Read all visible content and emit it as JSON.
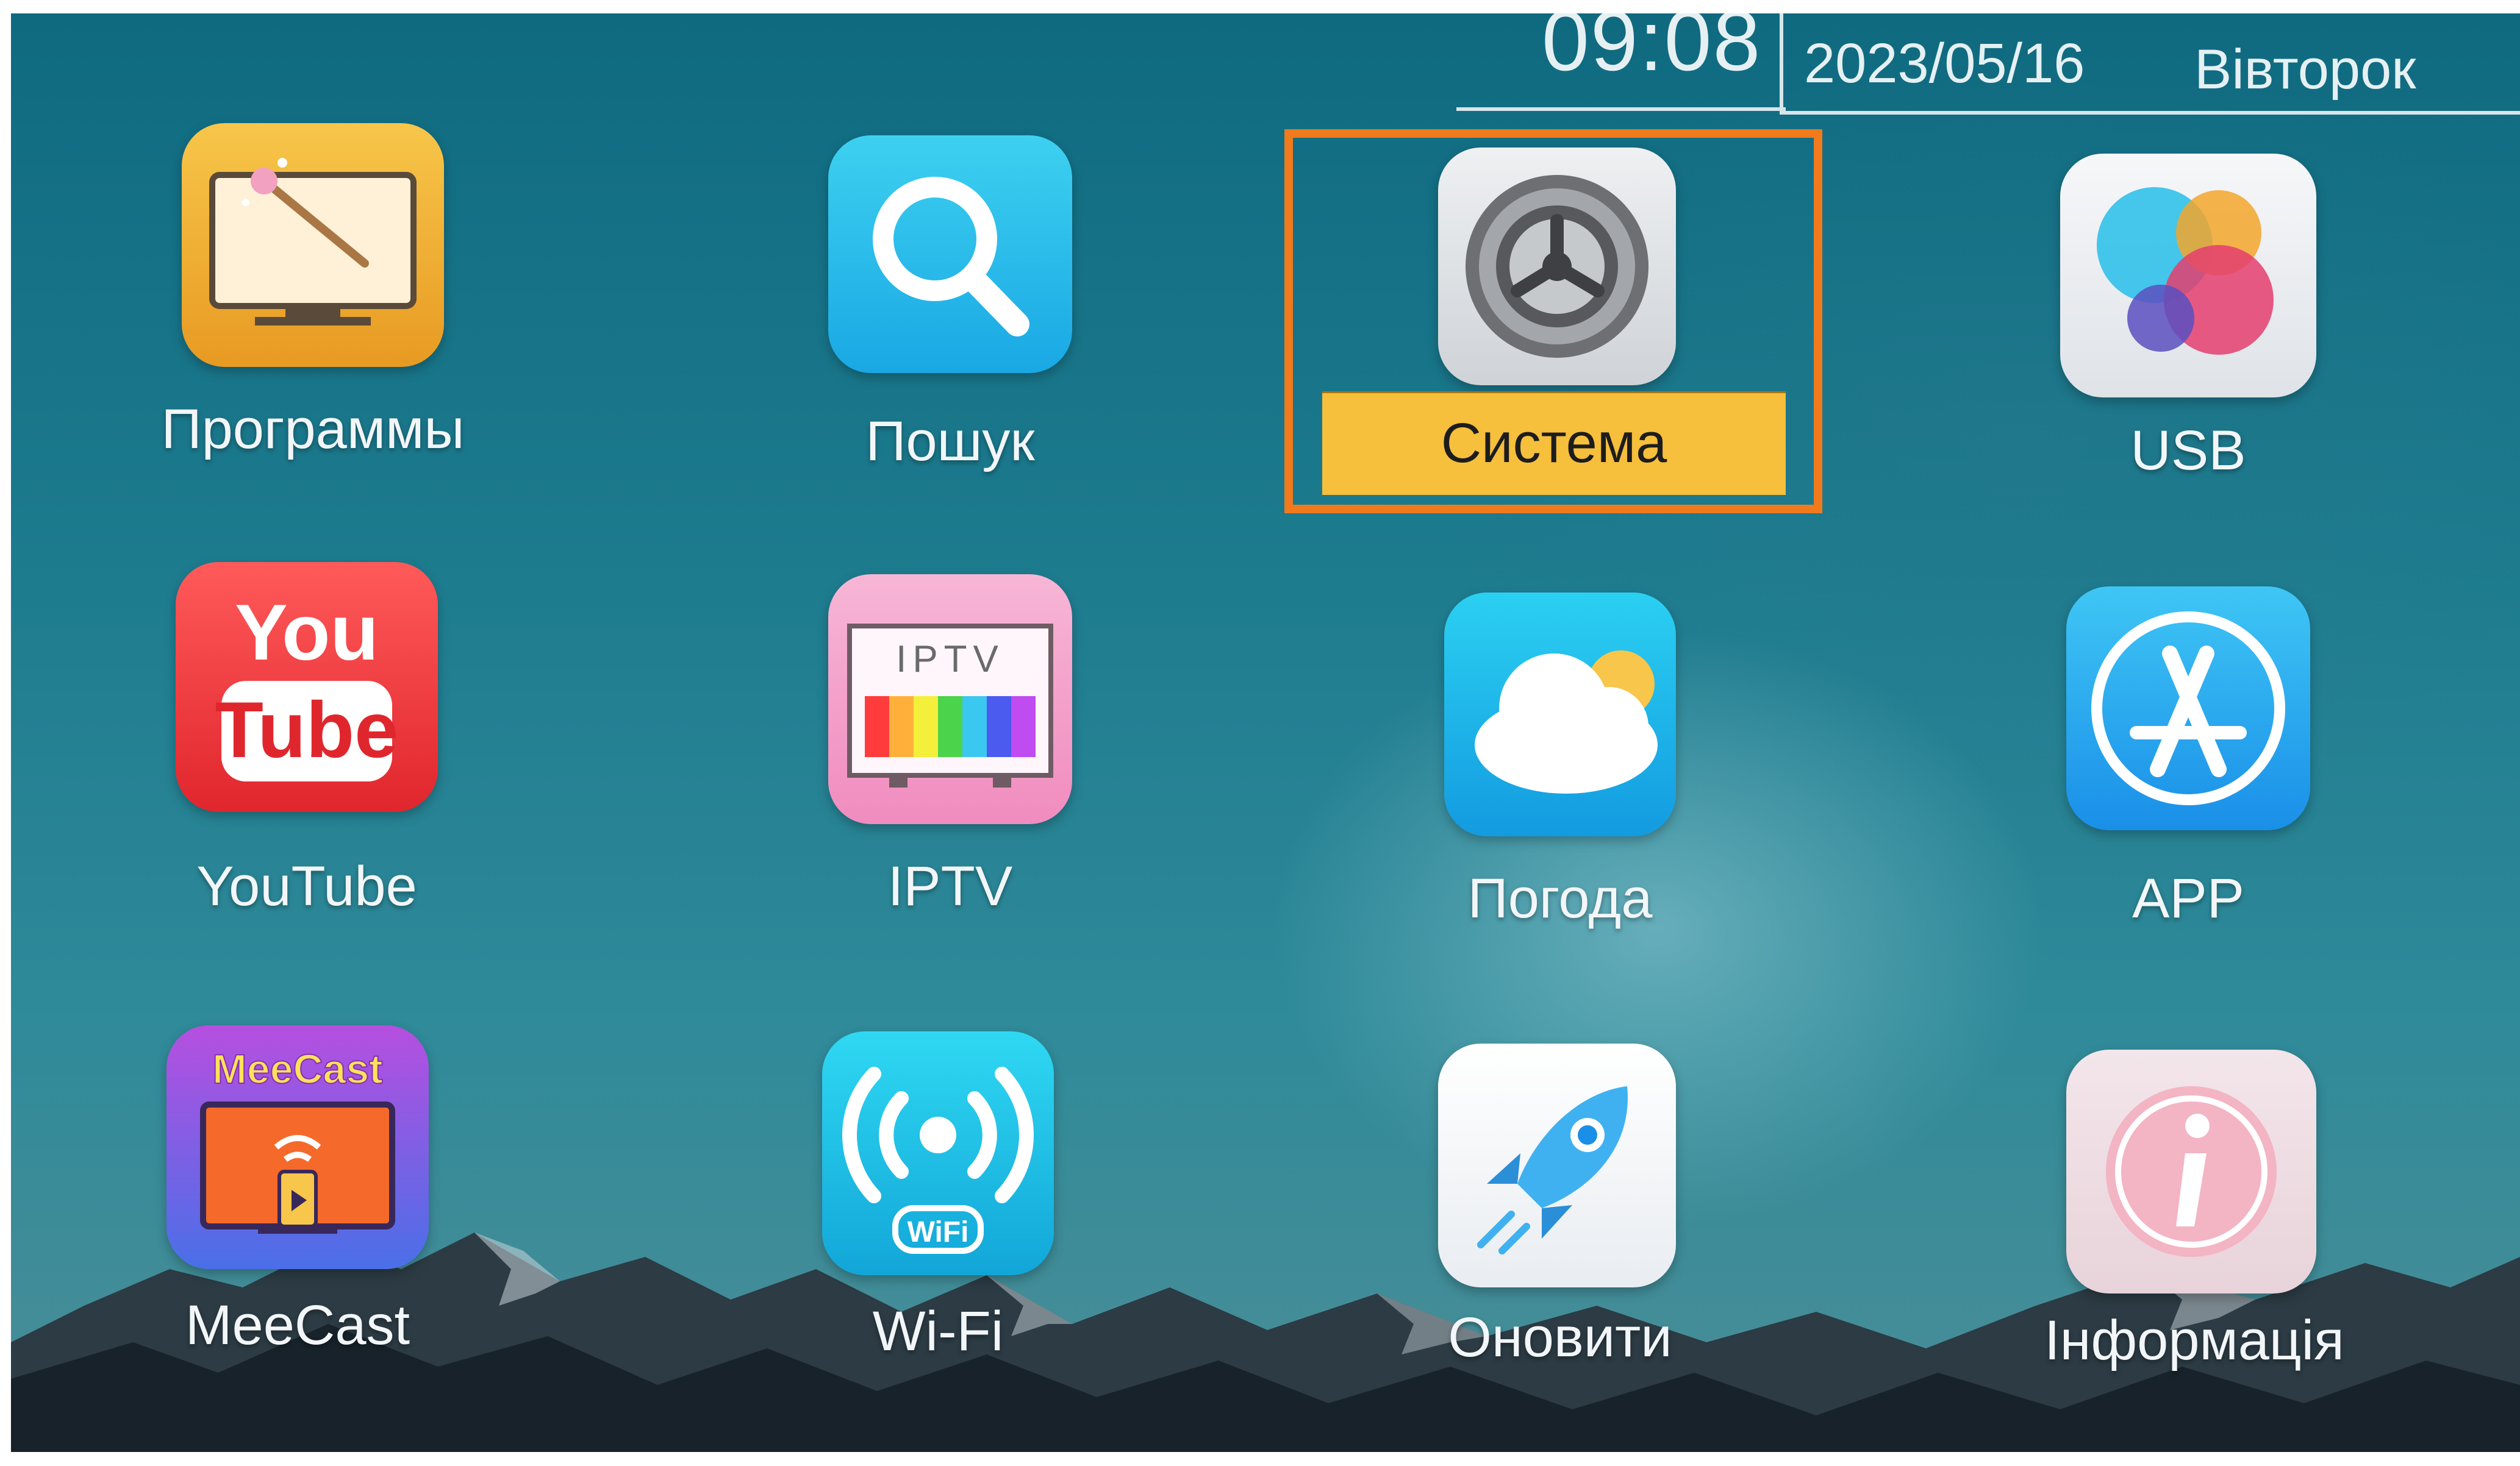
{
  "header": {
    "clock": "09:08",
    "date": "2023/05/16",
    "weekday": "Вівторок"
  },
  "apps": [
    {
      "label": "Программы",
      "icon": "tv-wizard-icon"
    },
    {
      "label": "Пошук",
      "icon": "search-icon"
    },
    {
      "label": "Система",
      "icon": "gear-icon",
      "selected": true
    },
    {
      "label": "USB",
      "icon": "usb-bubbles-icon"
    },
    {
      "label": "YouTube",
      "icon": "youtube-icon",
      "icon_text_top": "You",
      "icon_text_bottom": "Tube"
    },
    {
      "label": "IPTV",
      "icon": "iptv-icon",
      "icon_text": "IPTV"
    },
    {
      "label": "Погода",
      "icon": "weather-cloud-icon"
    },
    {
      "label": "APP",
      "icon": "app-store-icon"
    },
    {
      "label": "MeeCast",
      "icon": "meecast-icon",
      "icon_text": "MeeCast"
    },
    {
      "label": "Wi-Fi",
      "icon": "wifi-icon",
      "icon_text": "WiFi"
    },
    {
      "label": "Оновити",
      "icon": "rocket-update-icon"
    },
    {
      "label": "Інформація",
      "icon": "info-icon"
    }
  ],
  "colors": {
    "selection_frame": "#f07a1c",
    "selection_label_bg": "#f6bf3c"
  }
}
